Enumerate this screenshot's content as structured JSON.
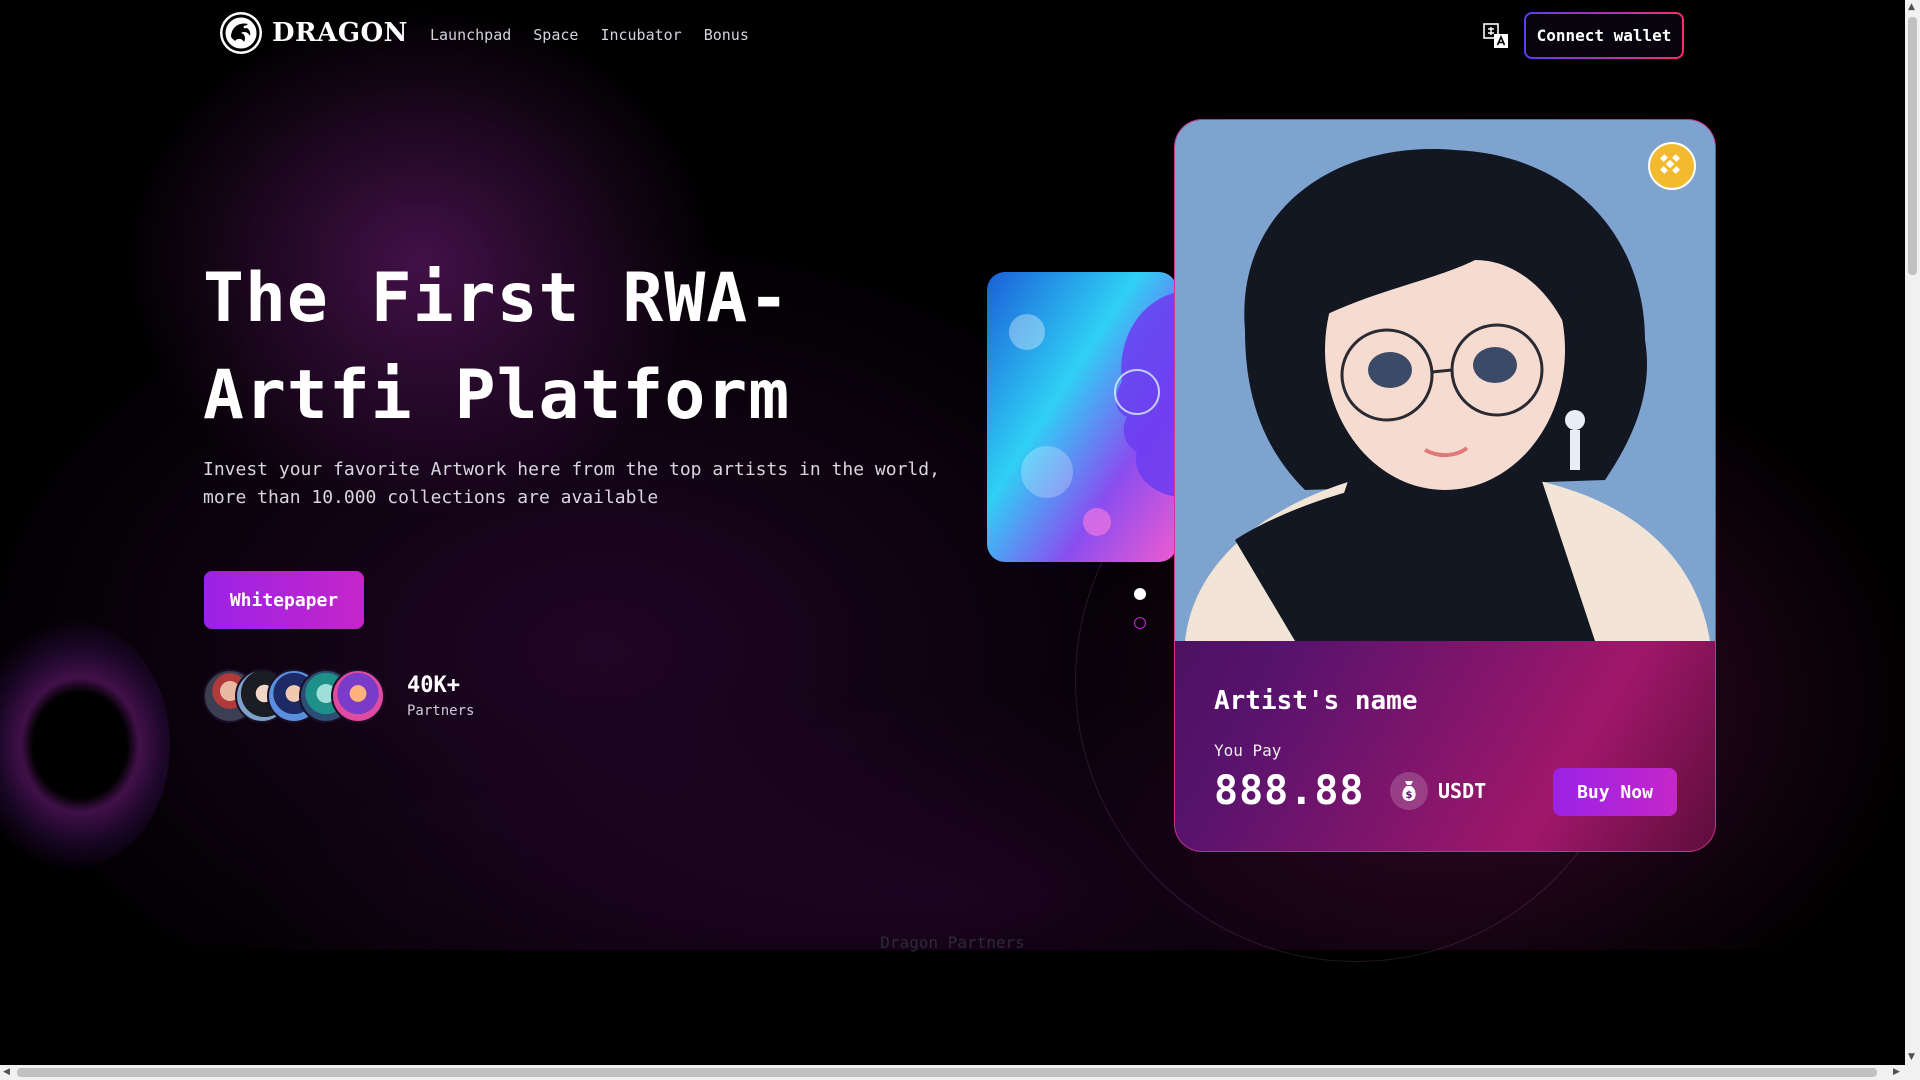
{
  "brand": {
    "name": "DRAGON"
  },
  "nav": {
    "links": [
      "Launchpad",
      "Space",
      "Incubator",
      "Bonus"
    ]
  },
  "header": {
    "connect_label": "Connect wallet",
    "translate_icon": "translate-icon"
  },
  "hero": {
    "title": "The First RWA-Artfi Platform",
    "subtitle": "Invest your favorite Artwork here from the top artists in the world, more than 10.000 collections are available",
    "cta_label": "Whitepaper",
    "partners_count": "40K+",
    "partners_label": "Partners"
  },
  "carousel": {
    "slide_count": 2,
    "active_slide": 1
  },
  "card": {
    "artist_name": "Artist's name",
    "you_pay_label": "You Pay",
    "price": "888.88",
    "currency": "USDT",
    "buy_label": "Buy Now",
    "chain_icon": "bnb-chain-icon"
  },
  "partners_section": {
    "heading": "Dragon Partners"
  },
  "colors": {
    "accent": "#b023d8",
    "chain_badge": "#f3ba2f",
    "background": "#000000"
  }
}
